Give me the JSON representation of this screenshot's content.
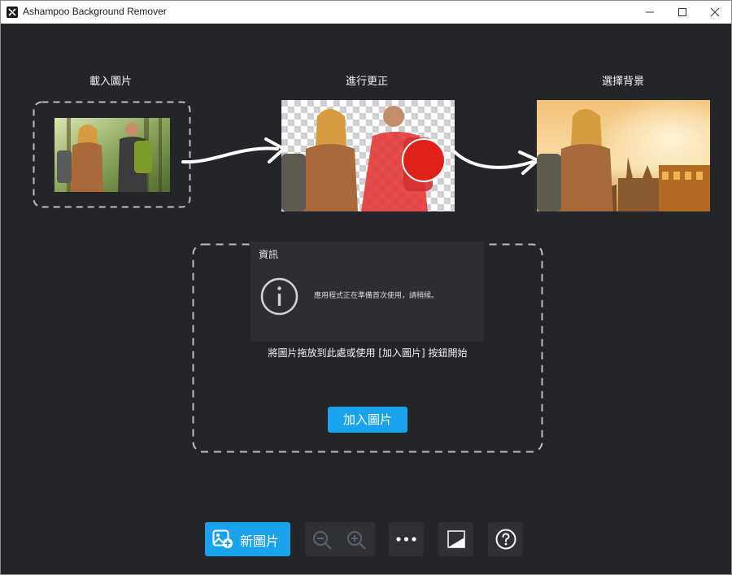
{
  "window": {
    "title": "Ashampoo Background Remover",
    "controls": [
      "minimize",
      "maximize",
      "close"
    ]
  },
  "steps": [
    {
      "label": "載入圖片",
      "icon": "original-photo"
    },
    {
      "label": "進行更正",
      "icon": "transparent-cutout-photo"
    },
    {
      "label": "選擇背景",
      "icon": "new-background-photo"
    }
  ],
  "info_dialog": {
    "title": "資訊",
    "icon": "info-circle-icon",
    "message": "應用程式正在準備首次使用，請稍候。"
  },
  "drop_zone": {
    "hint": "將圖片拖放到此處或使用 [加入圖片] 按鈕開始",
    "add_button_label": "加入圖片"
  },
  "toolbar": {
    "new_image_label": "新圖片",
    "buttons": [
      "zoom-out-icon",
      "zoom-in-icon",
      "more-icon",
      "compare-icon",
      "help-icon"
    ]
  },
  "colors": {
    "background": "#232529",
    "accent": "#1aa3ec",
    "panel": "#2c2e33",
    "button": "#2f3136"
  }
}
